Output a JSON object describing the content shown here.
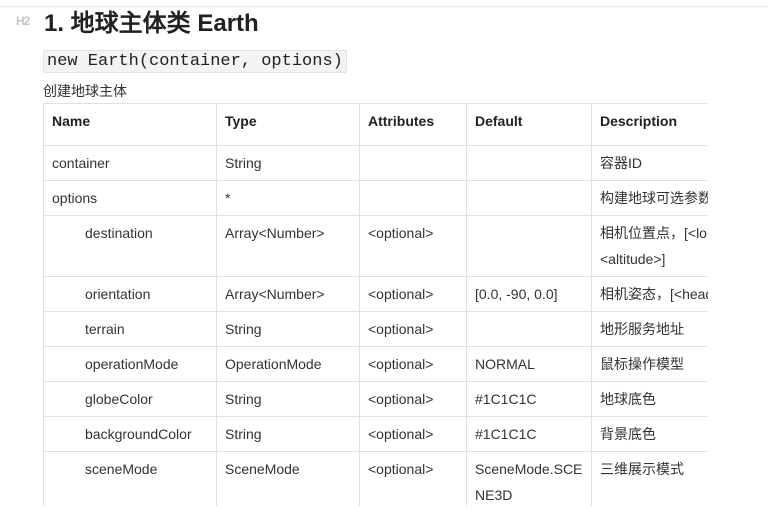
{
  "heading": {
    "marker": "H2",
    "text": "1. 地球主体类 Earth"
  },
  "signature": "new Earth(container, options)",
  "description": "创建地球主体",
  "table": {
    "headers": [
      "Name",
      "Type",
      "Attributes",
      "Default",
      "Description"
    ],
    "rows": [
      {
        "name": "container",
        "type": "String",
        "attributes": "",
        "default": "",
        "description": "容器ID"
      },
      {
        "name": "options",
        "type": "*",
        "attributes": "",
        "default": "",
        "description": "构建地球可选参数"
      },
      {
        "name": "destination",
        "type": "Array<Number>",
        "attributes": "<optional>",
        "default": "",
        "description": "相机位置点，[<lon>, <lat>, <altitude>]"
      },
      {
        "name": "orientation",
        "type": "Array<Number>",
        "attributes": "<optional>",
        "default": "[0.0, -90, 0.0]",
        "description": "相机姿态，[<heading>, <pitch>, <roll>]"
      },
      {
        "name": "terrain",
        "type": "String",
        "attributes": "<optional>",
        "default": "",
        "description": "地形服务地址"
      },
      {
        "name": "operationMode",
        "type": "OperationMode",
        "attributes": "<optional>",
        "default": "NORMAL",
        "description": "鼠标操作模型"
      },
      {
        "name": "globeColor",
        "type": "String",
        "attributes": "<optional>",
        "default": "#1C1C1C",
        "description": "地球底色"
      },
      {
        "name": "backgroundColor",
        "type": "String",
        "attributes": "<optional>",
        "default": "#1C1C1C",
        "description": "背景底色"
      },
      {
        "name": "sceneMode",
        "type": "SceneMode",
        "attributes": "<optional>",
        "default": "SceneMode.SCENE3D",
        "description": "三维展示模式"
      }
    ]
  }
}
